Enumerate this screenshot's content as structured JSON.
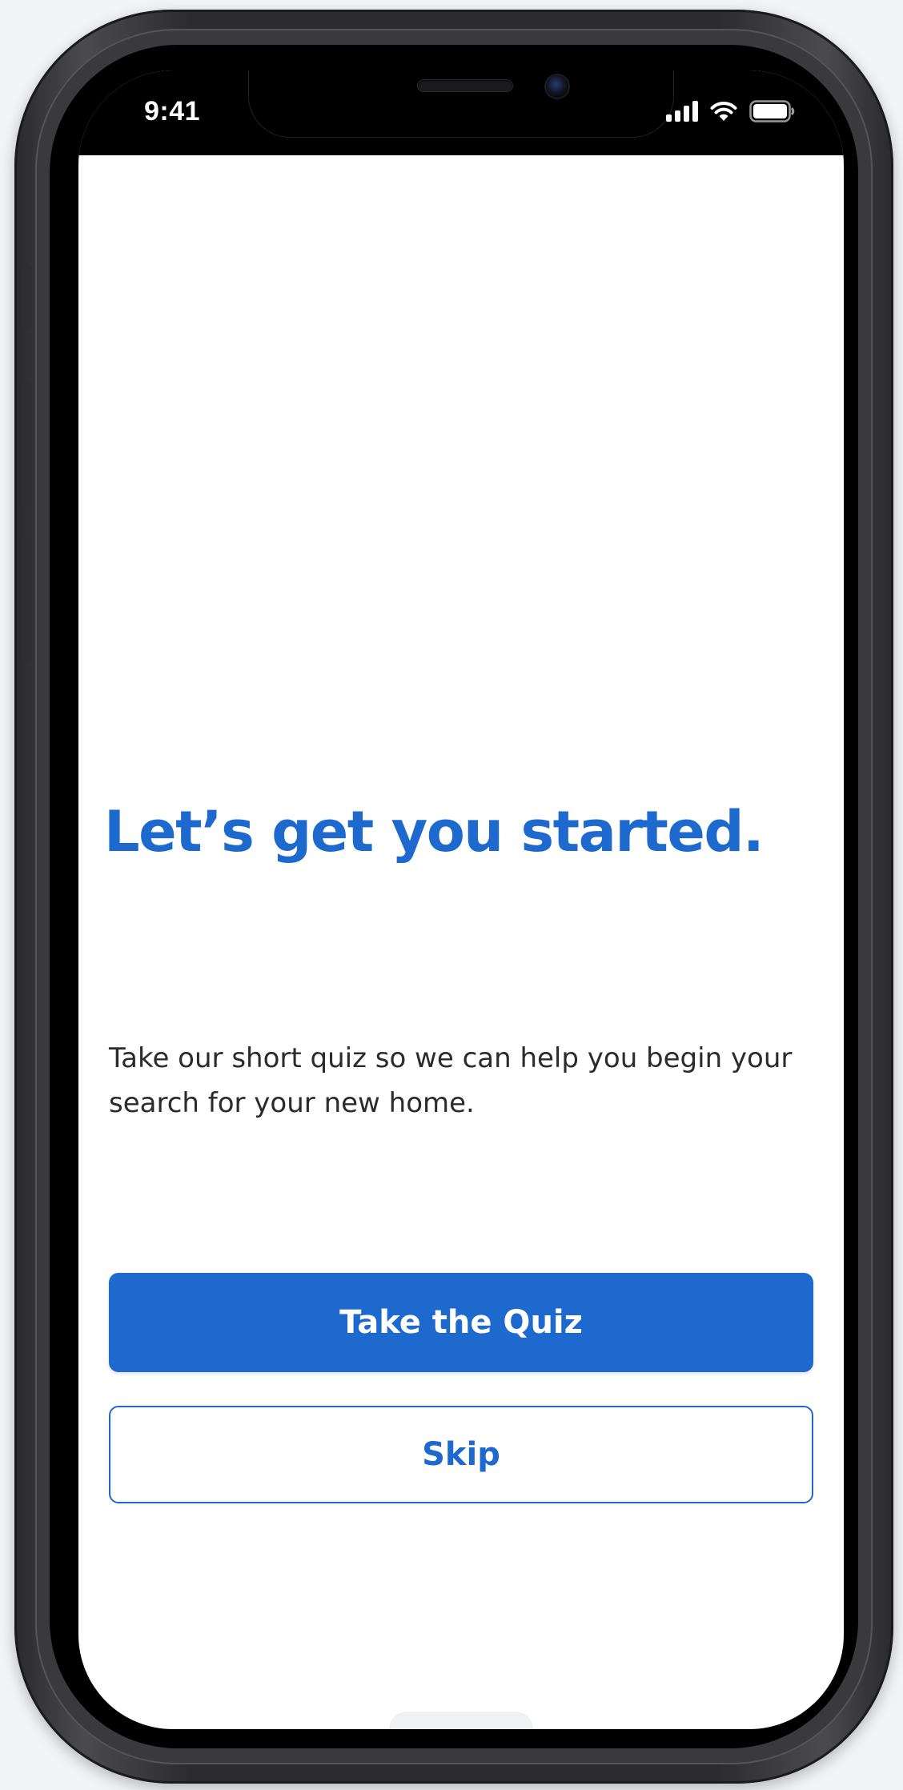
{
  "status_bar": {
    "time": "9:41",
    "icons": [
      "signal-icon",
      "wifi-icon",
      "battery-icon"
    ]
  },
  "onboarding": {
    "title": "Let’s get you started.",
    "description": "Take our short quiz so we can help you begin your search for your new home.",
    "primary_button_label": "Take the Quiz",
    "secondary_button_label": "Skip"
  },
  "colors": {
    "accent": "#1e69cd",
    "text": "#2b2b2b",
    "background": "#ffffff",
    "frame": "#2c2c2e"
  }
}
